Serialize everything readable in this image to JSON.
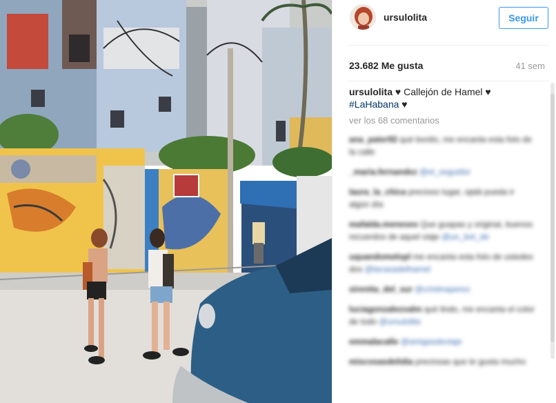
{
  "post": {
    "username": "ursulolita",
    "follow_label": "Seguir",
    "likes": "23.682 Me gusta",
    "time": "41 sem",
    "caption": {
      "user": "ursulolita",
      "heart1": "♥",
      "text": "Callejón de Hamel",
      "heart2": "♥",
      "hashtag": "#LaHabana",
      "heart3": "♥"
    },
    "view_comments": "ver los 68 comentarios"
  },
  "comments": [
    {
      "user": "ana_pater92",
      "text": "qué bonito, me encanta esta foto de la calle"
    },
    {
      "user": "_maria.fernandez",
      "text": "",
      "tag": "@el_seguidor"
    },
    {
      "user": "laura_la_chica",
      "text": "precioso lugar, ojalá pueda ir algún día"
    },
    {
      "user": "mafalda.meneses",
      "text": "Que guapas y original, buenos recuerdos de aquel viaje",
      "tag": "@un_bot_de"
    },
    {
      "user": "uquandomelopl",
      "text": "me encanta esta foto de ustedes dos",
      "tag": "@lacasadelhamel"
    },
    {
      "user": "sirenita_del_sur",
      "text": "",
      "tag": "@cristinaperez"
    },
    {
      "user": "luciagonzalezvalm",
      "text": "qué lindo, me encanta el color de todo",
      "tag": "@ursulolita"
    },
    {
      "user": "emmalacalle",
      "text": "",
      "tag": "@amigasdeviaje"
    },
    {
      "user": "miscosasdelidia",
      "text": "preciosas que te gusta mucho"
    }
  ],
  "colors": {
    "accent": "#3897f0",
    "hashtag": "#003569"
  }
}
